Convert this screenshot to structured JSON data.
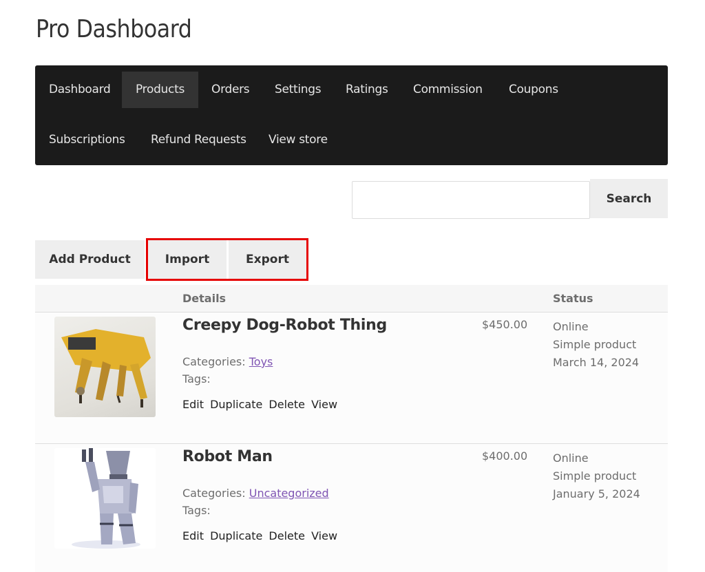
{
  "page": {
    "title": "Pro Dashboard"
  },
  "nav": {
    "items": [
      {
        "label": "Dashboard",
        "active": false
      },
      {
        "label": "Products",
        "active": true
      },
      {
        "label": "Orders",
        "active": false
      },
      {
        "label": "Settings",
        "active": false
      },
      {
        "label": "Ratings",
        "active": false
      },
      {
        "label": "Commission",
        "active": false
      },
      {
        "label": "Coupons",
        "active": false
      },
      {
        "label": "Subscriptions",
        "active": false
      },
      {
        "label": "Refund Requests",
        "active": false
      },
      {
        "label": "View store",
        "active": false
      }
    ]
  },
  "search": {
    "value": "",
    "placeholder": "",
    "button_label": "Search"
  },
  "actions": {
    "add_product": "Add Product",
    "import": "Import",
    "export": "Export"
  },
  "table": {
    "headers": {
      "details": "Details",
      "status": "Status"
    },
    "rows": [
      {
        "image": "yellow-robot-dog-image",
        "name": "Creepy Dog-Robot Thing",
        "categories_label": "Categories:",
        "category": "Toys",
        "tags_label": "Tags:",
        "actions": [
          "Edit",
          "Duplicate",
          "Delete",
          "View"
        ],
        "price": "$450.00",
        "status": "Online",
        "type": "Simple product",
        "date": "March 14, 2024"
      },
      {
        "image": "robot-man-image",
        "name": "Robot Man",
        "categories_label": "Categories:",
        "category": "Uncategorized",
        "tags_label": "Tags:",
        "actions": [
          "Edit",
          "Duplicate",
          "Delete",
          "View"
        ],
        "price": "$400.00",
        "status": "Online",
        "type": "Simple product",
        "date": "January 5, 2024"
      }
    ]
  },
  "colors": {
    "nav_bg": "#1b1b1b",
    "nav_active_bg": "#333333",
    "button_bg": "#eeeeee",
    "highlight": "#e60000",
    "link": "#7f54b3"
  }
}
